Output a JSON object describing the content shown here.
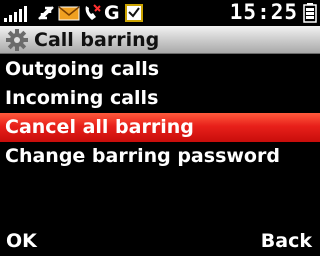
{
  "status_bar": {
    "time": "15:25",
    "icons": [
      "signal-strength-icon",
      "data-transfer-icon",
      "new-message-icon",
      "missed-call-icon",
      "gprs-icon",
      "calendar-alert-icon",
      "battery-icon"
    ],
    "network_type": "G"
  },
  "header": {
    "icon": "gear-icon",
    "title": "Call barring"
  },
  "menu": {
    "items": [
      {
        "label": "Outgoing calls",
        "selected": false
      },
      {
        "label": "Incoming calls",
        "selected": false
      },
      {
        "label": "Cancel all barring",
        "selected": true
      },
      {
        "label": "Change barring password",
        "selected": false
      }
    ]
  },
  "softkeys": {
    "left": "OK",
    "right": "Back"
  },
  "colors": {
    "highlight": "#e8201a",
    "background": "#000000",
    "title_bar": "#c9c9c9"
  }
}
